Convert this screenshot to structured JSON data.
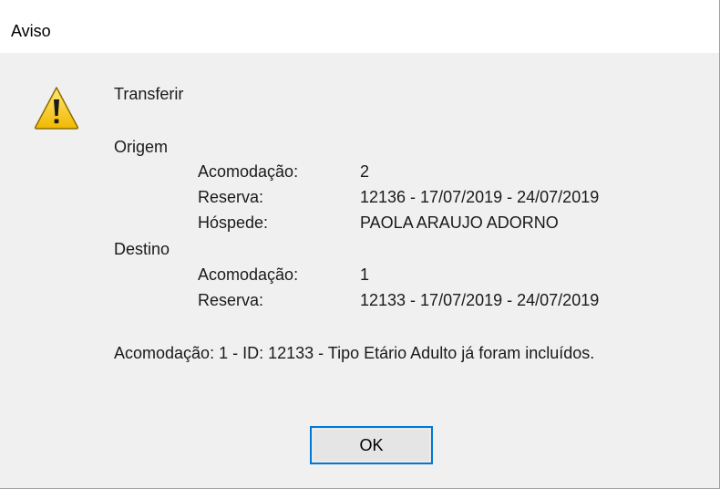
{
  "window": {
    "title": "Aviso"
  },
  "message": {
    "icon": "warning-icon",
    "heading": "Transferir",
    "origin": {
      "label": "Origem",
      "rows": [
        {
          "label": "Acomodação:",
          "value": "2"
        },
        {
          "label": "Reserva:",
          "value": "12136 - 17/07/2019 - 24/07/2019"
        },
        {
          "label": "Hóspede:",
          "value": "PAOLA ARAUJO ADORNO"
        }
      ]
    },
    "destination": {
      "label": "Destino",
      "rows": [
        {
          "label": "Acomodação:",
          "value": "1"
        },
        {
          "label": "Reserva:",
          "value": "12133 - 17/07/2019 - 24/07/2019"
        }
      ]
    },
    "footer": "Acomodação: 1 - ID: 12133 - Tipo Etário Adulto já foram incluídos."
  },
  "buttons": {
    "ok_label": "OK"
  },
  "colors": {
    "accent": "#0078d7",
    "warning": "#f5c400"
  }
}
